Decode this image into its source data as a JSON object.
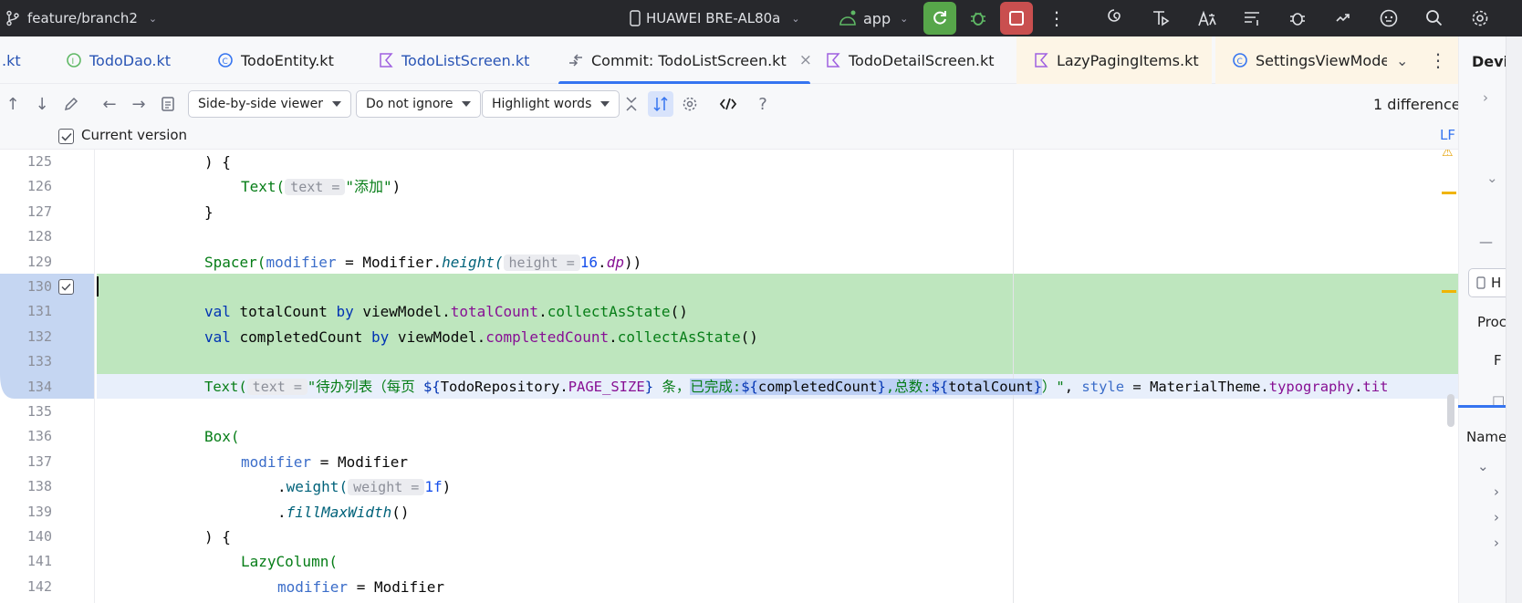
{
  "titlebar": {
    "branch": "feature/branch2",
    "device": "HUAWEI BRE-AL80a",
    "run_config": "app"
  },
  "tabs": [
    {
      "label": ".kt",
      "active": false
    },
    {
      "label": "TodoDao.kt",
      "active": false
    },
    {
      "label": "TodoEntity.kt",
      "active": false
    },
    {
      "label": "TodoListScreen.kt",
      "active": false
    },
    {
      "label": "Commit: TodoListScreen.kt",
      "active": true,
      "close": "×"
    },
    {
      "label": "TodoDetailScreen.kt",
      "active": false
    },
    {
      "label": "LazyPagingItems.kt",
      "active": false
    },
    {
      "label": "SettingsViewMode",
      "active": false
    }
  ],
  "diff_toolbar": {
    "viewer": "Side-by-side viewer",
    "ignore": "Do not ignore",
    "highlight": "Highlight words",
    "help": "?",
    "difference_count": "1 difference"
  },
  "current_version": {
    "label": "Current version",
    "line_separator": "LF"
  },
  "right_panel": {
    "title": "Devi",
    "item_h": "H",
    "item_proc": "Proc",
    "item_f": "F",
    "item_name": "Name"
  },
  "code_lines": [
    {
      "n": "125"
    },
    {
      "n": "126"
    },
    {
      "n": "127"
    },
    {
      "n": "128"
    },
    {
      "n": "129"
    },
    {
      "n": "130"
    },
    {
      "n": "131"
    },
    {
      "n": "132"
    },
    {
      "n": "133"
    },
    {
      "n": "134"
    },
    {
      "n": "135"
    },
    {
      "n": "136"
    },
    {
      "n": "137"
    },
    {
      "n": "138"
    },
    {
      "n": "139"
    },
    {
      "n": "140"
    },
    {
      "n": "141"
    },
    {
      "n": "142"
    }
  ],
  "code": {
    "l125": ") {",
    "l126_fn": "Text(",
    "l126_hint": "text =",
    "l126_str": "\"添加\"",
    "l126_end": ")",
    "l127": "}",
    "l129_fn": "Spacer(",
    "l129_param": "modifier",
    "l129_eq": " = Modifier.",
    "l129_call": "height(",
    "l129_hint": "height =",
    "l129_num": "16",
    "l129_dot": ".",
    "l129_prop": "dp",
    "l129_end": "))",
    "l131_kw": "val",
    "l131_var": " totalCount ",
    "l131_by": "by",
    "l131_vm": " viewModel.",
    "l131_prop": "totalCount",
    "l131_dot": ".",
    "l131_call": "collectAsState",
    "l131_end": "()",
    "l132_kw": "val",
    "l132_var": " completedCount ",
    "l132_by": "by",
    "l132_vm": " viewModel.",
    "l132_prop": "completedCount",
    "l132_dot": ".",
    "l132_call": "collectAsState",
    "l132_end": "()",
    "l134_fn": "Text(",
    "l134_hint": "text =",
    "l134_str1": "\"待办列表（每页 ",
    "l134_tpl1": "${",
    "l134_repo": "TodoRepository.",
    "l134_const": "PAGE_SIZE",
    "l134_tpl1e": "}",
    "l134_str2": " 条，",
    "l134_sel_str": "已完成:",
    "l134_sel_tpl": "${",
    "l134_sel_var": "completedCount",
    "l134_sel_tple": "}",
    "l134_sel_str2": ",总数:",
    "l134_sel_tpl2": "${",
    "l134_sel_var2": "totalCount",
    "l134_sel_tpl2e": "}",
    "l134_str3": "）\"",
    "l134_comma": ", ",
    "l134_style": "style",
    "l134_eq": " = MaterialTheme.",
    "l134_typo": "typography",
    "l134_dot": ".",
    "l134_tit": "tit",
    "l136_fn": "Box(",
    "l137_param": "modifier",
    "l137_rest": " = Modifier",
    "l138_dot": ".",
    "l138_call": "weight(",
    "l138_hint": "weight =",
    "l138_num": "1f",
    "l138_end": ")",
    "l139_dot": ".",
    "l139_call": "fillMaxWidth",
    "l139_end": "()",
    "l140": ") {",
    "l141_fn": "LazyColumn(",
    "l142_param": "modifier",
    "l142_rest": " = Modifier"
  }
}
